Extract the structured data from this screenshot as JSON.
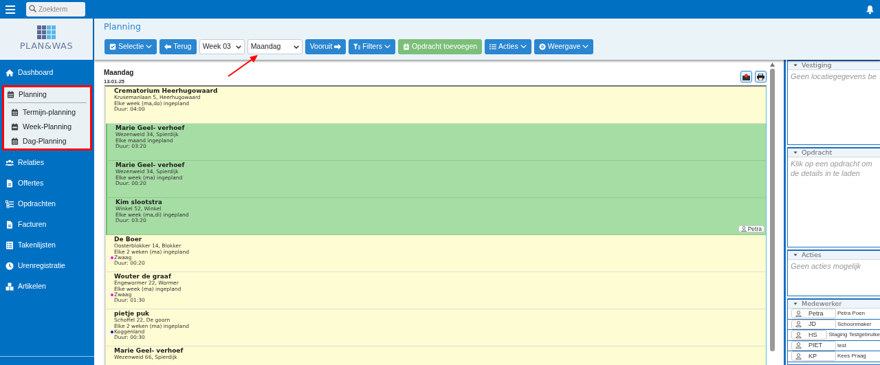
{
  "topbar": {
    "search": {
      "placeholder": "Zoekterm"
    }
  },
  "sidebar": {
    "logo": "PLAN&WAS",
    "items": [
      {
        "label": "Dashboard",
        "selected": false,
        "outlined": false
      },
      {
        "label": "Planning",
        "selected": true,
        "outlined": true,
        "children": [
          {
            "label": "Termijn-planning"
          },
          {
            "label": "Week-Planning"
          },
          {
            "label": "Dag-Planning"
          }
        ]
      },
      {
        "label": "Relaties",
        "selected": false,
        "outlined": false
      },
      {
        "label": "Offertes",
        "selected": false,
        "outlined": false
      },
      {
        "label": "Opdrachten",
        "selected": false,
        "outlined": false
      },
      {
        "label": "Facturen",
        "selected": false,
        "outlined": false
      },
      {
        "label": "Takenlijsten",
        "selected": false,
        "outlined": false
      },
      {
        "label": "Urenregistratie",
        "selected": false,
        "outlined": false
      },
      {
        "label": "Artikelen",
        "selected": false,
        "outlined": false
      }
    ]
  },
  "page": {
    "title": "Planning",
    "toolbar": [
      {
        "kind": "button",
        "label": "Selectie",
        "dropdown": true
      },
      {
        "kind": "button",
        "label": "Terug",
        "dropdown": false
      },
      {
        "kind": "select",
        "value": "Week 03"
      },
      {
        "kind": "select",
        "value": "Maandag",
        "annotated": true
      },
      {
        "kind": "button",
        "label": "Vooruit",
        "dropdown": false
      },
      {
        "kind": "button",
        "label": "Filters",
        "dropdown": true
      },
      {
        "kind": "button",
        "label": "Opdracht toevoegen",
        "dropdown": false
      },
      {
        "kind": "button",
        "label": "Acties",
        "dropdown": true
      },
      {
        "kind": "button",
        "label": "Weergave",
        "dropdown": true
      }
    ]
  },
  "day": {
    "name": "Maandag",
    "date": "13-01-25",
    "appointments": [
      {
        "title": "Crematorium Heerhugowaard",
        "address": "Krusemanlaan 5, Heerhugowaard",
        "schedule": "Elke week (ma,do) ingepland",
        "duration": "Duur: 04:00",
        "color": "#fefcd2"
      },
      {
        "title": "Marie Geel- verhoef",
        "address": "Wezenweid 34, Spierdijk",
        "schedule": "Elke maand ingepland",
        "duration": "Duur: 03:20",
        "color": "#a6dda5"
      },
      {
        "title": "Marie Geel- verhoef",
        "address": "Wezenweid 34, Spierdijk",
        "schedule": "Elke week (ma) ingepland",
        "duration": "Duur: 00:20",
        "color": "#a6dda5"
      },
      {
        "title": "Kim slootstra",
        "address": "Winkel 52, Winkel",
        "schedule": "Elke week (ma,di) ingepland",
        "duration": "Duur: 03:20",
        "color": "#a6dda5",
        "employee": "Petra"
      },
      {
        "title": "De Boer",
        "address": "Oosterblokker 14, Blokker",
        "schedule": "Elke 2 weken (ma) ingepland",
        "region": {
          "name": "Zwaag",
          "color": "#ff00ff"
        },
        "duration": "Duur: 00:20",
        "color": "#fefcd2"
      },
      {
        "title": "Wouter de graaf",
        "address": "Engewormer 22, Wormer",
        "schedule": "Elke week (ma) ingepland",
        "region": {
          "name": "Zwaag",
          "color": "#ff00ff"
        },
        "duration": "Duur: 01:30",
        "color": "#fefcd2"
      },
      {
        "title": "pietje puk",
        "address": "Schoffel 22, De goorn",
        "schedule": "Elke 2 weken (ma) ingepland",
        "region": {
          "name": "Koggenland",
          "color": "#0000ff"
        },
        "duration": "Duur: 00:30",
        "color": "#fefcd2"
      },
      {
        "title": "Marie Geel- verhoef",
        "address": "Wezenweid 66, Spierdijk",
        "color": "#fefcd2"
      }
    ]
  },
  "details": {
    "sections": [
      {
        "title": "Vestiging",
        "expanded": true,
        "text": "Geen locatiegegevens be"
      },
      {
        "title": "Opdracht",
        "expanded": true,
        "text": "Klik op een opdracht om de details in te laden"
      },
      {
        "title": "Acties",
        "expanded": true,
        "text": "Geen acties mogelijk"
      },
      {
        "title": "Medewerker",
        "expanded": true,
        "employees": [
          {
            "code": "Petra",
            "name": "Petra Poen"
          },
          {
            "code": "JD",
            "name": "Schoonmaker"
          },
          {
            "code": "HS",
            "name": "Staging Testgebruike"
          },
          {
            "code": "PIET",
            "name": "test"
          },
          {
            "code": "KP",
            "name": "Kees Praag"
          }
        ]
      }
    ]
  }
}
